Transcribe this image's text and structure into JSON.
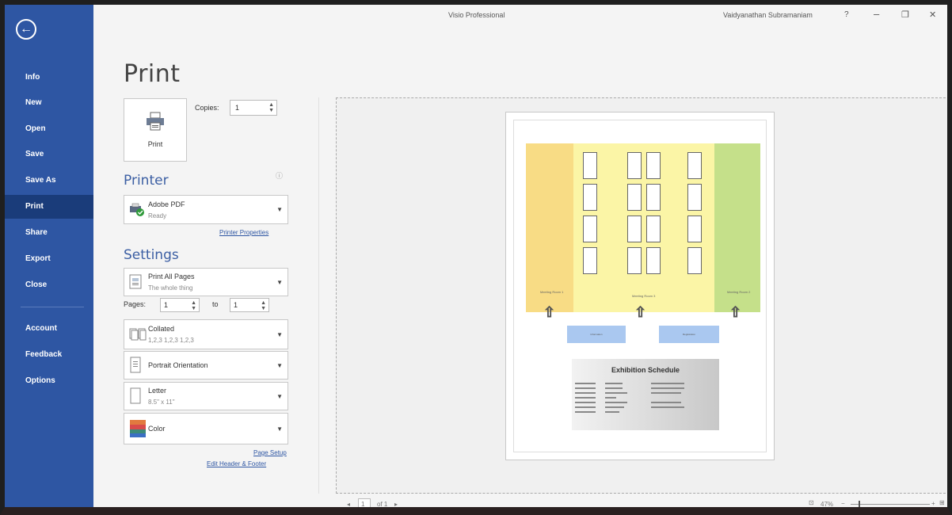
{
  "window": {
    "app_title": "Visio Professional",
    "user_name": "Vaidyanathan Subramaniam",
    "help": "?",
    "minimize": "–",
    "restore": "❐",
    "close": "✕"
  },
  "sidebar": {
    "back_icon": "←",
    "items": [
      {
        "label": "Info"
      },
      {
        "label": "New"
      },
      {
        "label": "Open"
      },
      {
        "label": "Save"
      },
      {
        "label": "Save As"
      },
      {
        "label": "Print"
      },
      {
        "label": "Share"
      },
      {
        "label": "Export"
      },
      {
        "label": "Close"
      },
      {
        "label": "Account"
      },
      {
        "label": "Feedback"
      },
      {
        "label": "Options"
      }
    ],
    "active": "Print",
    "bg_color": "#2e56a3"
  },
  "print": {
    "title": "Print",
    "button_label": "Print",
    "copies_label": "Copies:",
    "copies_value": "1"
  },
  "printer": {
    "heading": "Printer",
    "name": "Adobe PDF",
    "status": "Ready",
    "properties_link": "Printer Properties"
  },
  "settings": {
    "heading": "Settings",
    "range_title": "Print All Pages",
    "range_sub": "The whole thing",
    "pages_label": "Pages:",
    "pages_from": "1",
    "to_label": "to",
    "pages_to": "1",
    "collate_title": "Collated",
    "collate_sub": "1,2,3   1,2,3   1,2,3",
    "orientation": "Portrait Orientation",
    "paper_title": "Letter",
    "paper_sub": "8.5\" x 11\"",
    "color": "Color",
    "page_setup_link": "Page Setup",
    "header_footer_link": "Edit Header & Footer"
  },
  "preview": {
    "room_left": "Meeting Room 1",
    "room_center": "Meeting Room 3",
    "room_right": "Meeting Room 2",
    "kiosk_left": "Information",
    "kiosk_right": "Registration",
    "schedule_title": "Exhibition Schedule"
  },
  "statusbar": {
    "page_value": "1",
    "page_of": "of 1",
    "zoom": "47%"
  }
}
